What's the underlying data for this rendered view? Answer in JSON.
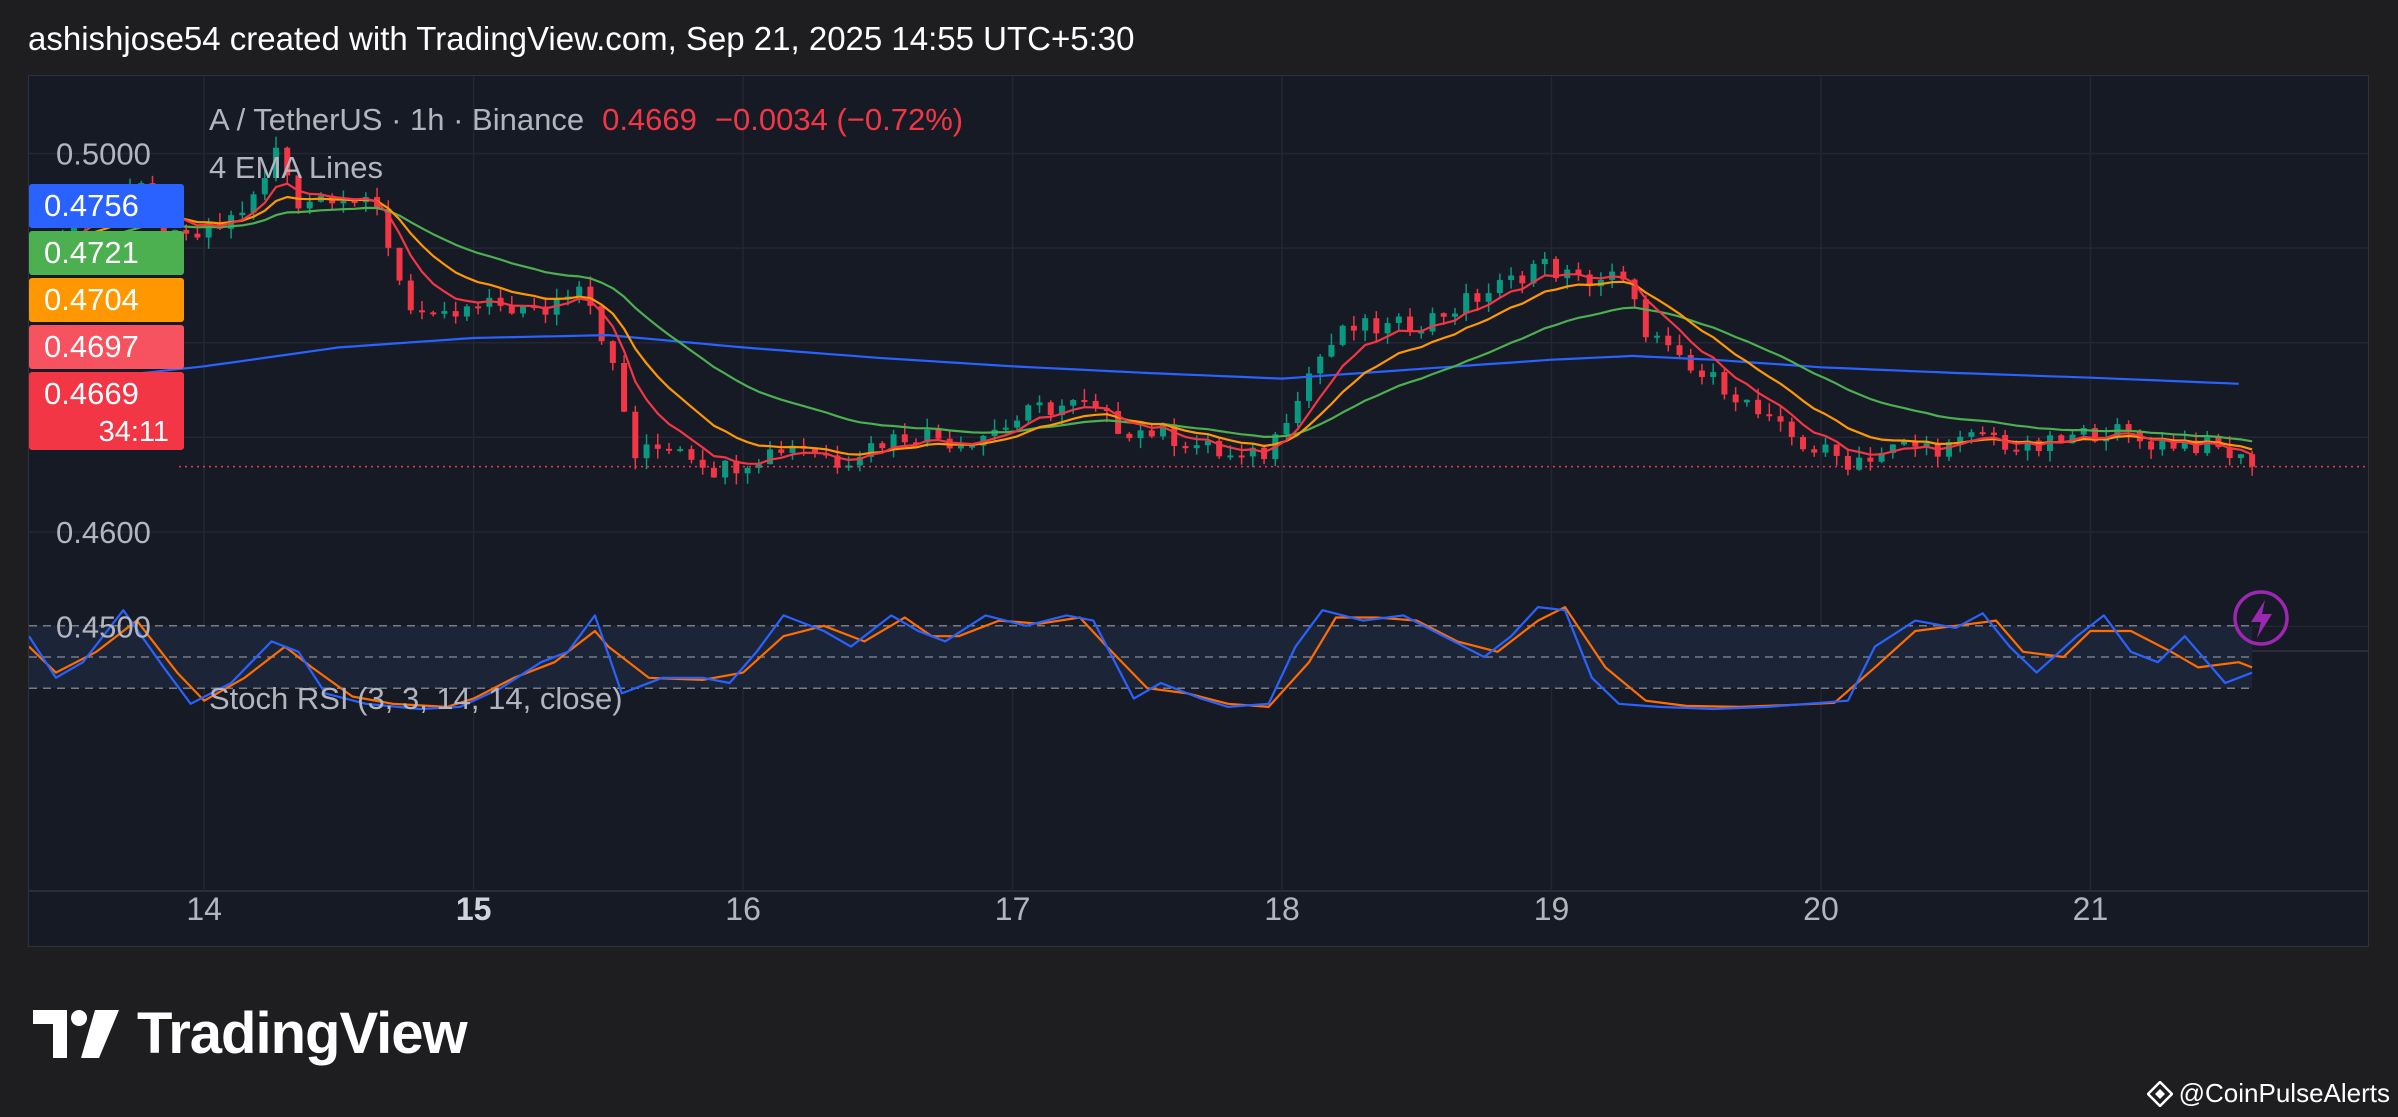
{
  "header": {
    "text": "ashishjose54 created with TradingView.com, Sep 21, 2025 14:55 UTC+5:30"
  },
  "brand": {
    "name": "TradingView",
    "watermark": "@CoinPulseAlerts"
  },
  "legend": {
    "symbol": "A / TetherUS · 1h · Binance",
    "price": "0.4669",
    "change": "−0.0034 (−0.72%)",
    "indicator": "4 EMA Lines",
    "oscillator": "Stoch RSI (3, 3, 14, 14, close)"
  },
  "price_tags": [
    {
      "label": "0.4756",
      "value": 0.4756,
      "color": "#2962ff"
    },
    {
      "label": "0.4721",
      "value": 0.4721,
      "color": "#4caf50"
    },
    {
      "label": "0.4704",
      "value": 0.4704,
      "color": "#ff9800"
    },
    {
      "label": "0.4697",
      "value": 0.4697,
      "color": "#f7525f"
    },
    {
      "label": "0.4669",
      "value": 0.4669,
      "color": "#f23645",
      "countdown": "34:11"
    }
  ],
  "colors": {
    "up": "#089981",
    "down": "#f23645",
    "ema_fast": "#f23645",
    "ema_mid": "#ff9800",
    "ema_slow": "#4caf50",
    "ema_long": "#2962ff",
    "stoch_k": "#2962ff",
    "stoch_d": "#ff6d00",
    "text": "#b2b5be",
    "lightning": "#9c27b0"
  },
  "chart_data": {
    "type": "candlestick",
    "interval": "1h",
    "x_ticks": [
      {
        "label": "14",
        "day": 14,
        "bold": false
      },
      {
        "label": "15",
        "day": 15,
        "bold": true
      },
      {
        "label": "16",
        "day": 16,
        "bold": false
      },
      {
        "label": "17",
        "day": 17,
        "bold": false
      },
      {
        "label": "18",
        "day": 18,
        "bold": false
      },
      {
        "label": "19",
        "day": 19,
        "bold": false
      },
      {
        "label": "20",
        "day": 20,
        "bold": false
      },
      {
        "label": "21",
        "day": 21,
        "bold": false
      }
    ],
    "y_ticks": [
      {
        "label": "0.5000",
        "value": 0.5
      },
      {
        "label": "0.4900",
        "value": 0.49
      },
      {
        "label": "0.4600",
        "value": 0.46
      },
      {
        "label": "0.4500",
        "value": 0.45
      }
    ],
    "ylim": [
      0.4474,
      0.5082
    ],
    "xlim": [
      13.35,
      22.03
    ],
    "last_price": 0.4669,
    "close_path": [
      [
        13.35,
        0.4885
      ],
      [
        13.55,
        0.4935
      ],
      [
        13.75,
        0.4965
      ],
      [
        13.9,
        0.4905
      ],
      [
        14.05,
        0.492
      ],
      [
        14.2,
        0.4955
      ],
      [
        14.27,
        0.5005
      ],
      [
        14.35,
        0.495
      ],
      [
        14.5,
        0.496
      ],
      [
        14.65,
        0.4935
      ],
      [
        14.75,
        0.4845
      ],
      [
        14.85,
        0.482
      ],
      [
        15.0,
        0.4835
      ],
      [
        15.1,
        0.484
      ],
      [
        15.25,
        0.483
      ],
      [
        15.4,
        0.487
      ],
      [
        15.5,
        0.479
      ],
      [
        15.6,
        0.468
      ],
      [
        15.75,
        0.4695
      ],
      [
        15.9,
        0.4665
      ],
      [
        16.05,
        0.468
      ],
      [
        16.2,
        0.4695
      ],
      [
        16.35,
        0.4675
      ],
      [
        16.5,
        0.4695
      ],
      [
        16.65,
        0.4705
      ],
      [
        16.8,
        0.4695
      ],
      [
        16.95,
        0.471
      ],
      [
        17.1,
        0.473
      ],
      [
        17.25,
        0.4735
      ],
      [
        17.4,
        0.471
      ],
      [
        17.55,
        0.4705
      ],
      [
        17.7,
        0.469
      ],
      [
        17.85,
        0.4675
      ],
      [
        17.95,
        0.4685
      ],
      [
        18.05,
        0.4745
      ],
      [
        18.15,
        0.479
      ],
      [
        18.25,
        0.4815
      ],
      [
        18.4,
        0.4815
      ],
      [
        18.55,
        0.4825
      ],
      [
        18.7,
        0.4845
      ],
      [
        18.85,
        0.4865
      ],
      [
        18.95,
        0.4885
      ],
      [
        19.1,
        0.4865
      ],
      [
        19.25,
        0.487
      ],
      [
        19.35,
        0.4815
      ],
      [
        19.5,
        0.477
      ],
      [
        19.65,
        0.4755
      ],
      [
        19.8,
        0.4715
      ],
      [
        19.95,
        0.469
      ],
      [
        20.1,
        0.4675
      ],
      [
        20.3,
        0.469
      ],
      [
        20.5,
        0.469
      ],
      [
        20.6,
        0.4705
      ],
      [
        20.75,
        0.4685
      ],
      [
        20.9,
        0.4695
      ],
      [
        21.05,
        0.471
      ],
      [
        21.2,
        0.4695
      ],
      [
        21.35,
        0.4695
      ],
      [
        21.5,
        0.4685
      ],
      [
        21.6,
        0.4669
      ]
    ],
    "ema_long_path": [
      [
        13.35,
        0.4755
      ],
      [
        14.0,
        0.4775
      ],
      [
        14.5,
        0.4795
      ],
      [
        15.0,
        0.4805
      ],
      [
        15.5,
        0.4808
      ],
      [
        16.0,
        0.4795
      ],
      [
        16.5,
        0.4784
      ],
      [
        17.0,
        0.4775
      ],
      [
        17.5,
        0.4768
      ],
      [
        18.0,
        0.4762
      ],
      [
        18.5,
        0.4772
      ],
      [
        19.0,
        0.4782
      ],
      [
        19.3,
        0.4786
      ],
      [
        19.6,
        0.4782
      ],
      [
        20.0,
        0.4774
      ],
      [
        20.5,
        0.4768
      ],
      [
        21.0,
        0.4763
      ],
      [
        21.6,
        0.4756
      ]
    ],
    "stoch_k": [
      [
        13.35,
        0.7
      ],
      [
        13.45,
        0.3
      ],
      [
        13.55,
        0.45
      ],
      [
        13.7,
        0.95
      ],
      [
        13.85,
        0.4
      ],
      [
        13.95,
        0.05
      ],
      [
        14.1,
        0.25
      ],
      [
        14.25,
        0.65
      ],
      [
        14.35,
        0.55
      ],
      [
        14.45,
        0.15
      ],
      [
        14.6,
        0.05
      ],
      [
        14.8,
        0.0
      ],
      [
        14.95,
        0.02
      ],
      [
        15.1,
        0.2
      ],
      [
        15.25,
        0.45
      ],
      [
        15.35,
        0.55
      ],
      [
        15.45,
        0.9
      ],
      [
        15.55,
        0.15
      ],
      [
        15.7,
        0.3
      ],
      [
        15.85,
        0.3
      ],
      [
        15.95,
        0.25
      ],
      [
        16.05,
        0.55
      ],
      [
        16.15,
        0.9
      ],
      [
        16.3,
        0.75
      ],
      [
        16.4,
        0.6
      ],
      [
        16.55,
        0.9
      ],
      [
        16.65,
        0.75
      ],
      [
        16.75,
        0.65
      ],
      [
        16.9,
        0.9
      ],
      [
        17.05,
        0.8
      ],
      [
        17.2,
        0.9
      ],
      [
        17.3,
        0.85
      ],
      [
        17.45,
        0.1
      ],
      [
        17.55,
        0.25
      ],
      [
        17.7,
        0.1
      ],
      [
        17.8,
        0.02
      ],
      [
        17.95,
        0.05
      ],
      [
        18.05,
        0.6
      ],
      [
        18.15,
        0.95
      ],
      [
        18.3,
        0.85
      ],
      [
        18.45,
        0.9
      ],
      [
        18.6,
        0.7
      ],
      [
        18.75,
        0.5
      ],
      [
        18.85,
        0.7
      ],
      [
        18.95,
        0.98
      ],
      [
        19.05,
        0.95
      ],
      [
        19.15,
        0.3
      ],
      [
        19.25,
        0.05
      ],
      [
        19.4,
        0.02
      ],
      [
        19.6,
        0.0
      ],
      [
        19.8,
        0.02
      ],
      [
        19.95,
        0.05
      ],
      [
        20.1,
        0.08
      ],
      [
        20.2,
        0.6
      ],
      [
        20.35,
        0.85
      ],
      [
        20.5,
        0.78
      ],
      [
        20.6,
        0.92
      ],
      [
        20.7,
        0.6
      ],
      [
        20.8,
        0.35
      ],
      [
        20.95,
        0.7
      ],
      [
        21.05,
        0.9
      ],
      [
        21.15,
        0.55
      ],
      [
        21.25,
        0.45
      ],
      [
        21.35,
        0.7
      ],
      [
        21.5,
        0.25
      ],
      [
        21.6,
        0.35
      ]
    ],
    "stoch_d": [
      [
        13.35,
        0.6
      ],
      [
        13.45,
        0.35
      ],
      [
        13.6,
        0.55
      ],
      [
        13.75,
        0.85
      ],
      [
        13.9,
        0.35
      ],
      [
        14.0,
        0.08
      ],
      [
        14.15,
        0.3
      ],
      [
        14.3,
        0.6
      ],
      [
        14.4,
        0.4
      ],
      [
        14.55,
        0.12
      ],
      [
        14.7,
        0.05
      ],
      [
        14.9,
        0.02
      ],
      [
        15.0,
        0.1
      ],
      [
        15.15,
        0.3
      ],
      [
        15.3,
        0.45
      ],
      [
        15.45,
        0.75
      ],
      [
        15.5,
        0.6
      ],
      [
        15.65,
        0.3
      ],
      [
        15.85,
        0.28
      ],
      [
        16.0,
        0.35
      ],
      [
        16.15,
        0.7
      ],
      [
        16.3,
        0.8
      ],
      [
        16.45,
        0.65
      ],
      [
        16.6,
        0.88
      ],
      [
        16.7,
        0.7
      ],
      [
        16.8,
        0.7
      ],
      [
        16.95,
        0.85
      ],
      [
        17.1,
        0.82
      ],
      [
        17.25,
        0.88
      ],
      [
        17.35,
        0.6
      ],
      [
        17.5,
        0.2
      ],
      [
        17.65,
        0.15
      ],
      [
        17.8,
        0.05
      ],
      [
        17.95,
        0.02
      ],
      [
        18.1,
        0.45
      ],
      [
        18.2,
        0.88
      ],
      [
        18.35,
        0.88
      ],
      [
        18.5,
        0.85
      ],
      [
        18.65,
        0.65
      ],
      [
        18.8,
        0.55
      ],
      [
        18.95,
        0.85
      ],
      [
        19.05,
        0.98
      ],
      [
        19.2,
        0.4
      ],
      [
        19.35,
        0.08
      ],
      [
        19.5,
        0.03
      ],
      [
        19.7,
        0.02
      ],
      [
        19.9,
        0.04
      ],
      [
        20.05,
        0.06
      ],
      [
        20.2,
        0.4
      ],
      [
        20.35,
        0.75
      ],
      [
        20.5,
        0.8
      ],
      [
        20.65,
        0.85
      ],
      [
        20.75,
        0.55
      ],
      [
        20.9,
        0.5
      ],
      [
        21.0,
        0.75
      ],
      [
        21.15,
        0.75
      ],
      [
        21.3,
        0.55
      ],
      [
        21.4,
        0.4
      ],
      [
        21.55,
        0.45
      ],
      [
        21.6,
        0.4
      ]
    ]
  }
}
